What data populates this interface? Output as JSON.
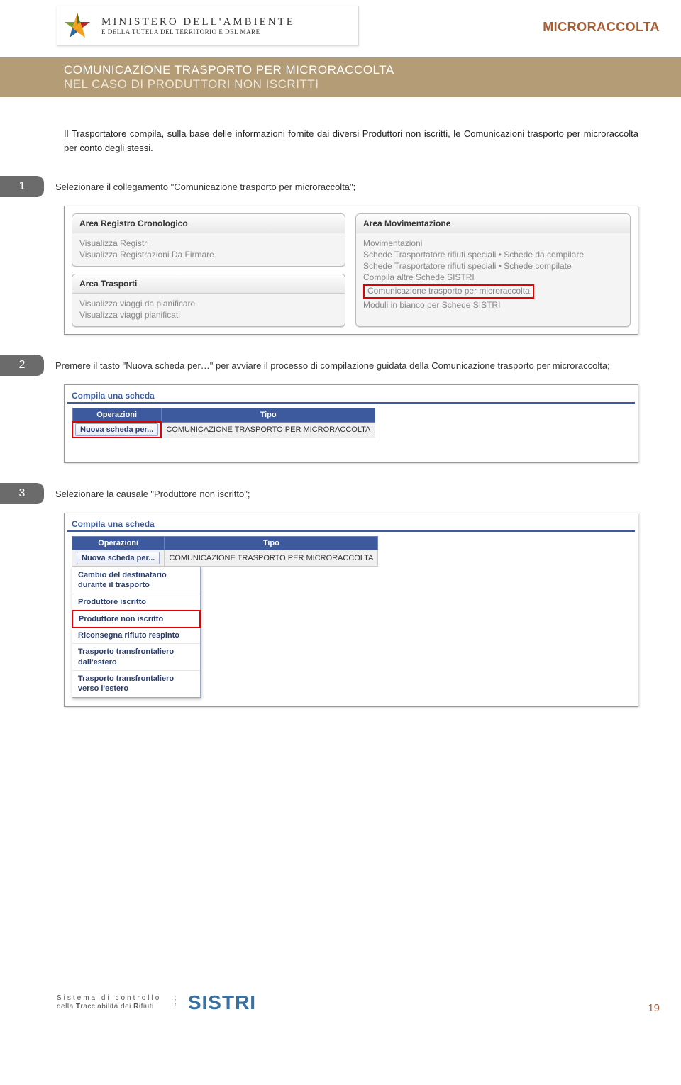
{
  "header": {
    "ministry_line1": "MINISTERO DELL'AMBIENTE",
    "ministry_line2": "E DELLA TUTELA DEL TERRITORIO E DEL MARE",
    "doc_label": "MICRORACCOLTA"
  },
  "title": {
    "line1": "COMUNICAZIONE TRASPORTO PER MICRORACCOLTA",
    "line2": "NEL CASO DI PRODUTTORI NON ISCRITTI"
  },
  "intro": "Il Trasportatore compila, sulla base delle informazioni fornite dai diversi Produttori non iscritti, le Comunicazioni trasporto per microraccolta per conto degli stessi.",
  "steps": {
    "s1": {
      "num": "1",
      "text": "Selezionare il collegamento \"Comunicazione trasporto per microraccolta\";"
    },
    "s2": {
      "num": "2",
      "text": "Premere il tasto \"Nuova scheda per…\" per avviare il processo di compilazione guidata della Comunicazione trasporto per microraccolta;"
    },
    "s3": {
      "num": "3",
      "text": "Selezionare la  causale \"Produttore non iscritto\";"
    }
  },
  "shot1": {
    "panelA": {
      "title": "Area Registro Cronologico",
      "items": [
        "Visualizza Registri",
        "Visualizza Registrazioni Da Firmare"
      ]
    },
    "panelB": {
      "title": "Area Trasporti",
      "items": [
        "Visualizza viaggi da pianificare",
        "Visualizza viaggi pianificati"
      ]
    },
    "panelC": {
      "title": "Area Movimentazione",
      "items": [
        "Movimentazioni",
        "Schede Trasportatore rifiuti speciali • Schede da compilare",
        "Schede Trasportatore rifiuti speciali • Schede compilate",
        "Compila altre Schede SISTRI"
      ],
      "highlight": "Comunicazione trasporto per microraccolta",
      "after": "Moduli in bianco per Schede SISTRI"
    }
  },
  "shot2": {
    "title": "Compila una scheda",
    "col1": "Operazioni",
    "col2": "Tipo",
    "btn": "Nuova scheda per...",
    "tipo": "COMUNICAZIONE TRASPORTO PER MICRORACCOLTA"
  },
  "shot3": {
    "title": "Compila una scheda",
    "col1": "Operazioni",
    "col2": "Tipo",
    "btn": "Nuova scheda per...",
    "tipo": "COMUNICAZIONE TRASPORTO PER MICRORACCOLTA",
    "dropdown": [
      "Cambio del destinatario durante il trasporto",
      "Produttore iscritto",
      "Produttore non iscritto",
      "Riconsegna rifiuto respinto",
      "Trasporto transfrontaliero dall'estero",
      "Trasporto transfrontaliero verso l'estero"
    ],
    "highlight_index": 2
  },
  "footer": {
    "line1": "Sistema di controllo",
    "line2_a": "della ",
    "line2_b": "T",
    "line2_c": "racciabilità dei ",
    "line2_d": "R",
    "line2_e": "ifiuti",
    "brand": "SISTRI",
    "page": "19"
  }
}
